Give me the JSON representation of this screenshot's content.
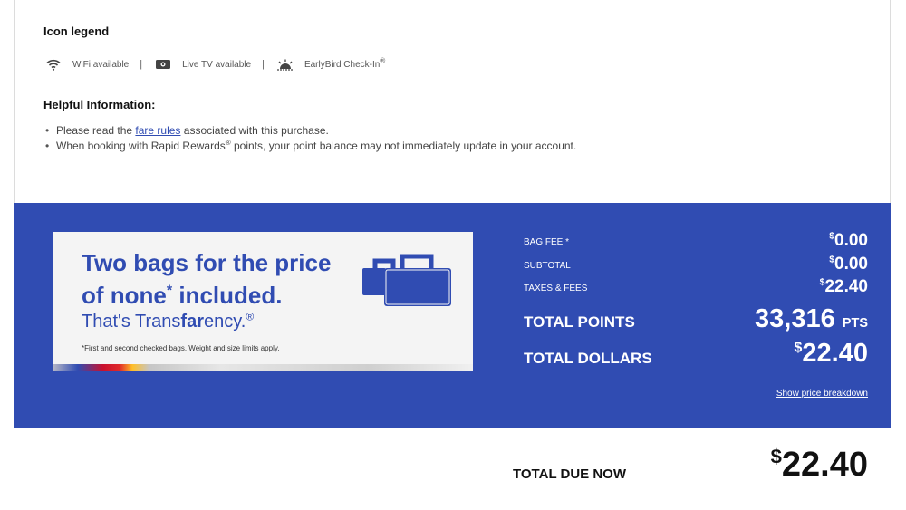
{
  "legend": {
    "title": "Icon legend",
    "items": [
      {
        "icon": "wifi-icon",
        "label": "WiFi available"
      },
      {
        "icon": "live-tv-icon",
        "label": "Live TV available"
      },
      {
        "icon": "earlybird-icon",
        "label": "EarlyBird Check-In",
        "suffix": "®"
      }
    ],
    "separator": "|"
  },
  "helpful": {
    "title": "Helpful Information:",
    "item1_prefix": "Please read the ",
    "item1_link": "fare rules",
    "item1_suffix": " associated with this purchase.",
    "item2_prefix": "When booking with Rapid Rewards",
    "item2_reg": "®",
    "item2_suffix": " points, your point balance may not immediately update in your account."
  },
  "promo": {
    "headline_line1": "Two bags for the price",
    "headline_line2_a": "of none",
    "headline_star": "*",
    "headline_line2_b": " included.",
    "sub_a": "That's Trans",
    "sub_b": "far",
    "sub_c": "ency.",
    "sub_reg": "®",
    "fine_print": "*First and second checked bags. Weight and size limits apply."
  },
  "fees": {
    "bag_fee_label": "BAG FEE *",
    "bag_fee_currency": "$",
    "bag_fee_value": "0.00",
    "subtotal_label": "SUBTOTAL",
    "subtotal_currency": "$",
    "subtotal_value": "0.00",
    "taxes_label": "TAXES & FEES",
    "taxes_currency": "$",
    "taxes_value": "22.40",
    "total_points_label": "TOTAL POINTS",
    "total_points_value": "33,316",
    "total_points_unit": "PTS",
    "total_dollars_label": "TOTAL DOLLARS",
    "total_dollars_currency": "$",
    "total_dollars_value": "22.40",
    "breakdown_link": "Show price breakdown"
  },
  "due": {
    "label": "TOTAL DUE NOW",
    "currency": "$",
    "value": "22.40"
  },
  "colors": {
    "brand_blue": "#304cb2",
    "text_dark": "#111111"
  }
}
